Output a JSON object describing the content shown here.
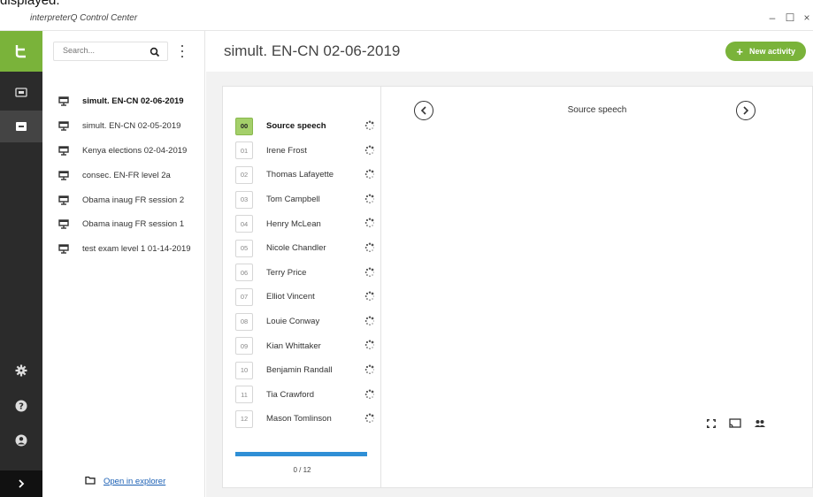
{
  "caption": {
    "text": "displayed."
  },
  "window": {
    "title": "interpreterQ Control Center",
    "controls": {
      "minimize": "–",
      "maximize": "☐",
      "close": "×"
    }
  },
  "list": {
    "search_placeholder": "Search...",
    "sessions": [
      {
        "label": "simult. EN-CN 02-06-2019",
        "active": true
      },
      {
        "label": "simult. EN-CN 02-05-2019",
        "active": false
      },
      {
        "label": "Kenya elections 02-04-2019",
        "active": false
      },
      {
        "label": "consec. EN-FR level 2a",
        "active": false
      },
      {
        "label": "Obama inaug FR session 2",
        "active": false
      },
      {
        "label": "Obama inaug FR session 1",
        "active": false
      },
      {
        "label": "test exam level 1 01-14-2019",
        "active": false
      }
    ],
    "open_explorer": "Open in explorer"
  },
  "header": {
    "title": "simult. EN-CN 02-06-2019",
    "new_activity": "New activity",
    "new_activity_plus": "+"
  },
  "channels": [
    {
      "num": "00",
      "name": "Source speech"
    },
    {
      "num": "01",
      "name": "Irene Frost"
    },
    {
      "num": "02",
      "name": "Thomas Lafayette"
    },
    {
      "num": "03",
      "name": "Tom Campbell"
    },
    {
      "num": "04",
      "name": "Henry McLean"
    },
    {
      "num": "05",
      "name": "Nicole Chandler"
    },
    {
      "num": "06",
      "name": "Terry Price"
    },
    {
      "num": "07",
      "name": "Elliot Vincent"
    },
    {
      "num": "08",
      "name": "Louie Conway"
    },
    {
      "num": "09",
      "name": "Kian Whittaker"
    },
    {
      "num": "10",
      "name": "Benjamin Randall"
    },
    {
      "num": "11",
      "name": "Tia Crawford"
    },
    {
      "num": "12",
      "name": "Mason Tomlinson"
    }
  ],
  "progress": {
    "label": "0 / 12",
    "fraction": 1.0
  },
  "viewer": {
    "title": "Source speech"
  },
  "colors": {
    "accent": "#7ab33a",
    "rail": "#2b2b2b",
    "progress": "#2f8fd6",
    "link": "#1a5fb4"
  },
  "icons": {
    "rail": [
      "logo-icon",
      "recordings-icon",
      "inbox-icon",
      "gear-icon",
      "help-icon",
      "user-icon",
      "chevron-right-icon"
    ],
    "viewer": [
      "expand-icon",
      "cast-icon",
      "people-icon"
    ]
  }
}
